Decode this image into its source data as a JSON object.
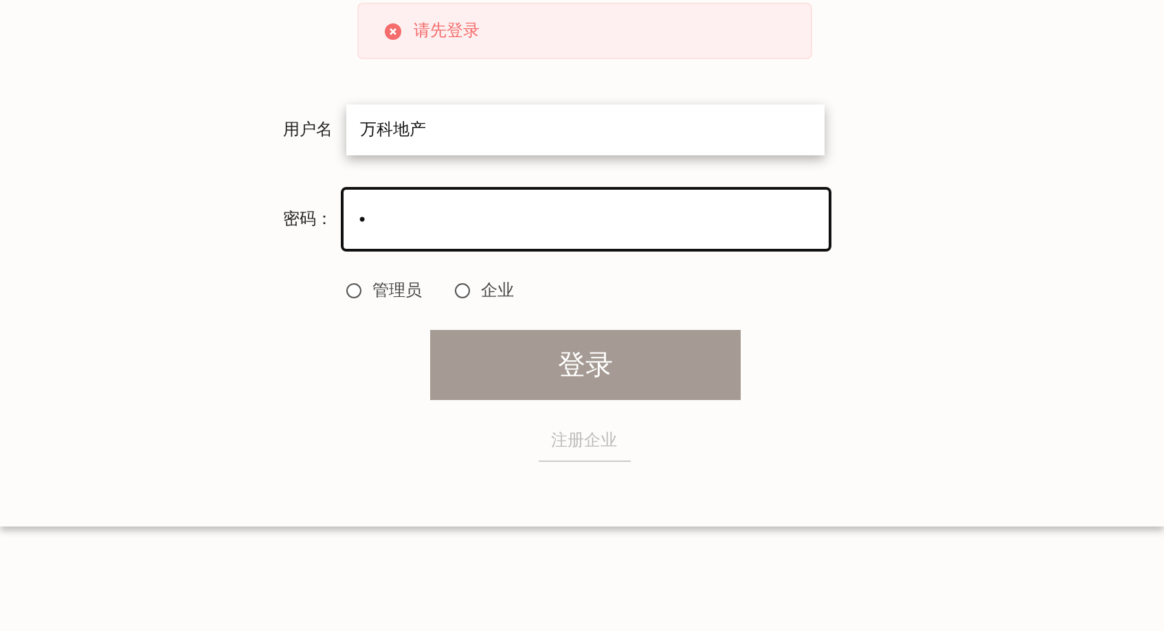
{
  "toast": {
    "kind": "error",
    "message": "请先登录"
  },
  "form": {
    "fields": [
      {
        "label": "用户名",
        "value": "万科地产",
        "focused": false
      },
      {
        "label": "密码：",
        "value": "•",
        "focused": true
      }
    ],
    "roles": [
      {
        "label": "管理员",
        "selected": false
      },
      {
        "label": "企业",
        "selected": false
      }
    ],
    "submit": "登录",
    "register_link": "注册企业"
  }
}
